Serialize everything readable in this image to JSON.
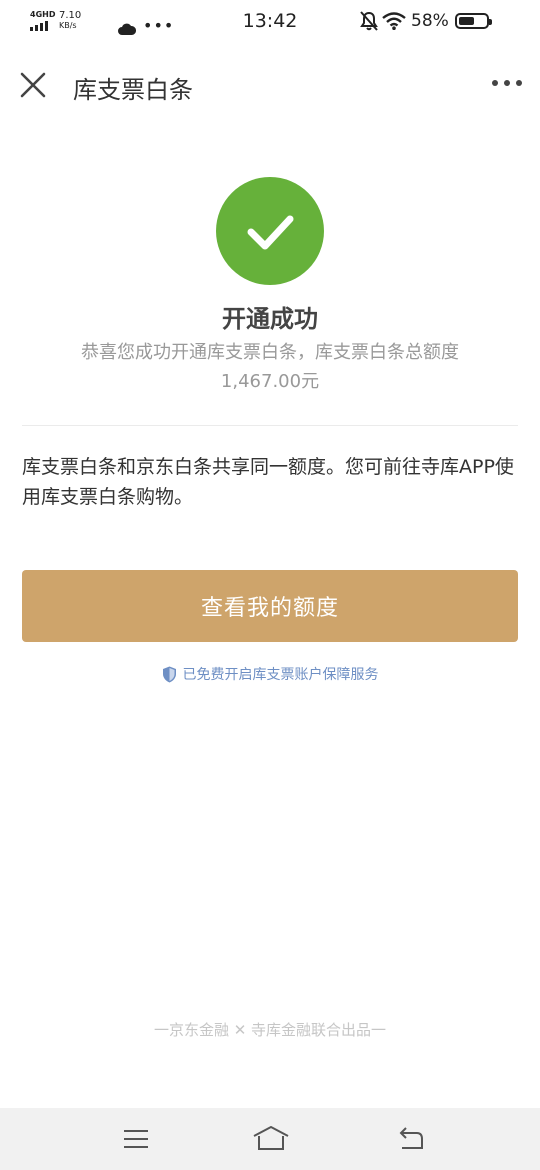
{
  "status_bar": {
    "network": "4GHD",
    "speed_value": "7.10",
    "speed_unit": "KB/s",
    "time": "13:42",
    "battery_percent": "58%",
    "battery_level": 0.58
  },
  "header": {
    "title": "库支票白条"
  },
  "success": {
    "title": "开通成功",
    "description": "恭喜您成功开通库支票白条，库支票白条总额度1,467.00元",
    "check_color": "#66b13a"
  },
  "info": {
    "text": "库支票白条和京东白条共享同一额度。您可前往寺库APP使用库支票白条购物。"
  },
  "primary_button": {
    "label": "查看我的额度",
    "color": "#cea46b"
  },
  "protection": {
    "text": "已免费开启库支票账户保障服务"
  },
  "footer": {
    "brand": "一京东金融 ✕ 寺库金融联合出品一"
  }
}
